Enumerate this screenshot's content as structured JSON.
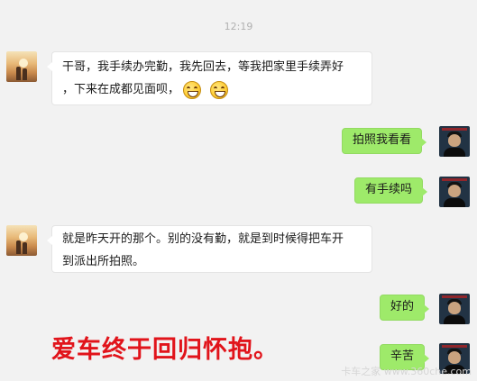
{
  "chat": {
    "timestamp": "12:19",
    "messages": [
      {
        "side": "in",
        "lines": [
          "干哥，我手续办完勤，我先回去，等我把家里手续弄好",
          "，下来在成都见面呗，"
        ],
        "emoji_count": 2,
        "emoji": "grin-emoji"
      },
      {
        "side": "out",
        "text": "拍照我看看"
      },
      {
        "side": "out",
        "text": "有手续吗"
      },
      {
        "side": "in",
        "lines": [
          "就是昨天开的那个。别的没有勤，就是到时候得把车开",
          "到派出所拍照。"
        ]
      },
      {
        "side": "out",
        "text": "好的"
      },
      {
        "side": "out",
        "text": "辛苦"
      }
    ]
  },
  "caption": {
    "text": "爱车终于回归怀抱。",
    "color": "#e1141b"
  },
  "watermark": {
    "text": "卡车之家 www.360che.com"
  },
  "colors": {
    "background": "#f2f2f2",
    "incoming_bubble": "#ffffff",
    "outgoing_bubble": "#9eea6a",
    "timestamp": "#b0b0b0"
  }
}
